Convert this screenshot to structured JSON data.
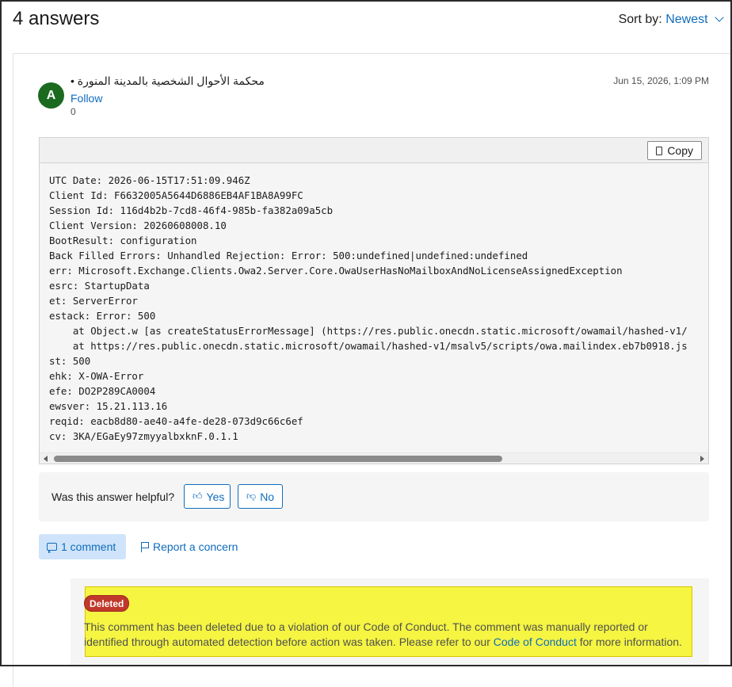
{
  "answers_heading": "4 answers",
  "sort": {
    "label": "Sort by:",
    "value": "Newest"
  },
  "answer": {
    "avatar_letter": "A",
    "author": "محكمة الأحوال الشخصية بالمدينة المنورة •",
    "follow_label": "Follow",
    "reputation": "0",
    "date": "Jun 15, 2026, 1:09 PM",
    "copy_label": "Copy",
    "code": "UTC Date: 2026-06-15T17:51:09.946Z\nClient Id: F6632005A5644D6886EB4AF1BA8A99FC\nSession Id: 116d4b2b-7cd8-46f4-985b-fa382a09a5cb\nClient Version: 20260608008.10\nBootResult: configuration\nBack Filled Errors: Unhandled Rejection: Error: 500:undefined|undefined:undefined\nerr: Microsoft.Exchange.Clients.Owa2.Server.Core.OwaUserHasNoMailboxAndNoLicenseAssignedException\nesrc: StartupData\net: ServerError\nestack: Error: 500\n    at Object.w [as createStatusErrorMessage] (https://res.public.onecdn.static.microsoft/owamail/hashed-v1/\n    at https://res.public.onecdn.static.microsoft/owamail/hashed-v1/msalv5/scripts/owa.mailindex.eb7b0918.js\nst: 500\nehk: X-OWA-Error\nefe: DO2P289CA0004\newsver: 15.21.113.16\nreqid: eacb8d80-ae40-a4fe-de28-073d9c66c6ef\ncv: 3KA/EGaEy97zmyyalbxknF.0.1.1",
    "helpful_question": "Was this answer helpful?",
    "yes_label": "Yes",
    "no_label": "No",
    "comments_label": "1 comment",
    "report_label": "Report a concern"
  },
  "deleted_comment": {
    "badge": "Deleted",
    "text_before": "This comment has been deleted due to a violation of our Code of Conduct. The comment was manually reported or identified through automated detection before action was taken. Please refer to our ",
    "link": "Code of Conduct",
    "text_after": " for more information."
  },
  "colors": {
    "accent": "#0f6cbd",
    "avatar": "#1a6a1f",
    "deleted_badge": "#c0392b",
    "highlight": "#f5f542"
  }
}
